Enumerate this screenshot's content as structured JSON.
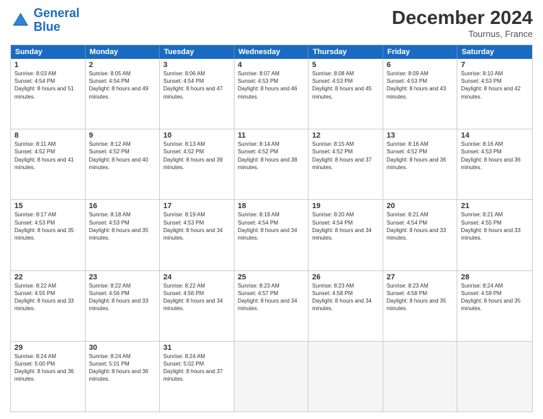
{
  "logo": {
    "line1": "General",
    "line2": "Blue"
  },
  "title": "December 2024",
  "subtitle": "Tournus, France",
  "days": [
    "Sunday",
    "Monday",
    "Tuesday",
    "Wednesday",
    "Thursday",
    "Friday",
    "Saturday"
  ],
  "weeks": [
    [
      {
        "day": "1",
        "sunrise": "8:03 AM",
        "sunset": "4:54 PM",
        "daylight": "8 hours and 51 minutes."
      },
      {
        "day": "2",
        "sunrise": "8:05 AM",
        "sunset": "4:54 PM",
        "daylight": "8 hours and 49 minutes."
      },
      {
        "day": "3",
        "sunrise": "8:06 AM",
        "sunset": "4:54 PM",
        "daylight": "8 hours and 47 minutes."
      },
      {
        "day": "4",
        "sunrise": "8:07 AM",
        "sunset": "4:53 PM",
        "daylight": "8 hours and 46 minutes."
      },
      {
        "day": "5",
        "sunrise": "8:08 AM",
        "sunset": "4:53 PM",
        "daylight": "8 hours and 45 minutes."
      },
      {
        "day": "6",
        "sunrise": "8:09 AM",
        "sunset": "4:53 PM",
        "daylight": "8 hours and 43 minutes."
      },
      {
        "day": "7",
        "sunrise": "8:10 AM",
        "sunset": "4:53 PM",
        "daylight": "8 hours and 42 minutes."
      }
    ],
    [
      {
        "day": "8",
        "sunrise": "8:11 AM",
        "sunset": "4:52 PM",
        "daylight": "8 hours and 41 minutes."
      },
      {
        "day": "9",
        "sunrise": "8:12 AM",
        "sunset": "4:52 PM",
        "daylight": "8 hours and 40 minutes."
      },
      {
        "day": "10",
        "sunrise": "8:13 AM",
        "sunset": "4:52 PM",
        "daylight": "8 hours and 39 minutes."
      },
      {
        "day": "11",
        "sunrise": "8:14 AM",
        "sunset": "4:52 PM",
        "daylight": "8 hours and 38 minutes."
      },
      {
        "day": "12",
        "sunrise": "8:15 AM",
        "sunset": "4:52 PM",
        "daylight": "8 hours and 37 minutes."
      },
      {
        "day": "13",
        "sunrise": "8:16 AM",
        "sunset": "4:52 PM",
        "daylight": "8 hours and 36 minutes."
      },
      {
        "day": "14",
        "sunrise": "8:16 AM",
        "sunset": "4:53 PM",
        "daylight": "8 hours and 36 minutes."
      }
    ],
    [
      {
        "day": "15",
        "sunrise": "8:17 AM",
        "sunset": "4:53 PM",
        "daylight": "8 hours and 35 minutes."
      },
      {
        "day": "16",
        "sunrise": "8:18 AM",
        "sunset": "4:53 PM",
        "daylight": "8 hours and 35 minutes."
      },
      {
        "day": "17",
        "sunrise": "8:19 AM",
        "sunset": "4:53 PM",
        "daylight": "8 hours and 34 minutes."
      },
      {
        "day": "18",
        "sunrise": "8:19 AM",
        "sunset": "4:54 PM",
        "daylight": "8 hours and 34 minutes."
      },
      {
        "day": "19",
        "sunrise": "8:20 AM",
        "sunset": "4:54 PM",
        "daylight": "8 hours and 34 minutes."
      },
      {
        "day": "20",
        "sunrise": "8:21 AM",
        "sunset": "4:54 PM",
        "daylight": "8 hours and 33 minutes."
      },
      {
        "day": "21",
        "sunrise": "8:21 AM",
        "sunset": "4:55 PM",
        "daylight": "8 hours and 33 minutes."
      }
    ],
    [
      {
        "day": "22",
        "sunrise": "8:22 AM",
        "sunset": "4:55 PM",
        "daylight": "8 hours and 33 minutes."
      },
      {
        "day": "23",
        "sunrise": "8:22 AM",
        "sunset": "4:56 PM",
        "daylight": "8 hours and 33 minutes."
      },
      {
        "day": "24",
        "sunrise": "8:22 AM",
        "sunset": "4:56 PM",
        "daylight": "8 hours and 34 minutes."
      },
      {
        "day": "25",
        "sunrise": "8:23 AM",
        "sunset": "4:57 PM",
        "daylight": "8 hours and 34 minutes."
      },
      {
        "day": "26",
        "sunrise": "8:23 AM",
        "sunset": "4:58 PM",
        "daylight": "8 hours and 34 minutes."
      },
      {
        "day": "27",
        "sunrise": "8:23 AM",
        "sunset": "4:58 PM",
        "daylight": "8 hours and 35 minutes."
      },
      {
        "day": "28",
        "sunrise": "8:24 AM",
        "sunset": "4:59 PM",
        "daylight": "8 hours and 35 minutes."
      }
    ],
    [
      {
        "day": "29",
        "sunrise": "8:24 AM",
        "sunset": "5:00 PM",
        "daylight": "8 hours and 36 minutes."
      },
      {
        "day": "30",
        "sunrise": "8:24 AM",
        "sunset": "5:01 PM",
        "daylight": "8 hours and 36 minutes."
      },
      {
        "day": "31",
        "sunrise": "8:24 AM",
        "sunset": "5:02 PM",
        "daylight": "8 hours and 37 minutes."
      },
      null,
      null,
      null,
      null
    ]
  ]
}
